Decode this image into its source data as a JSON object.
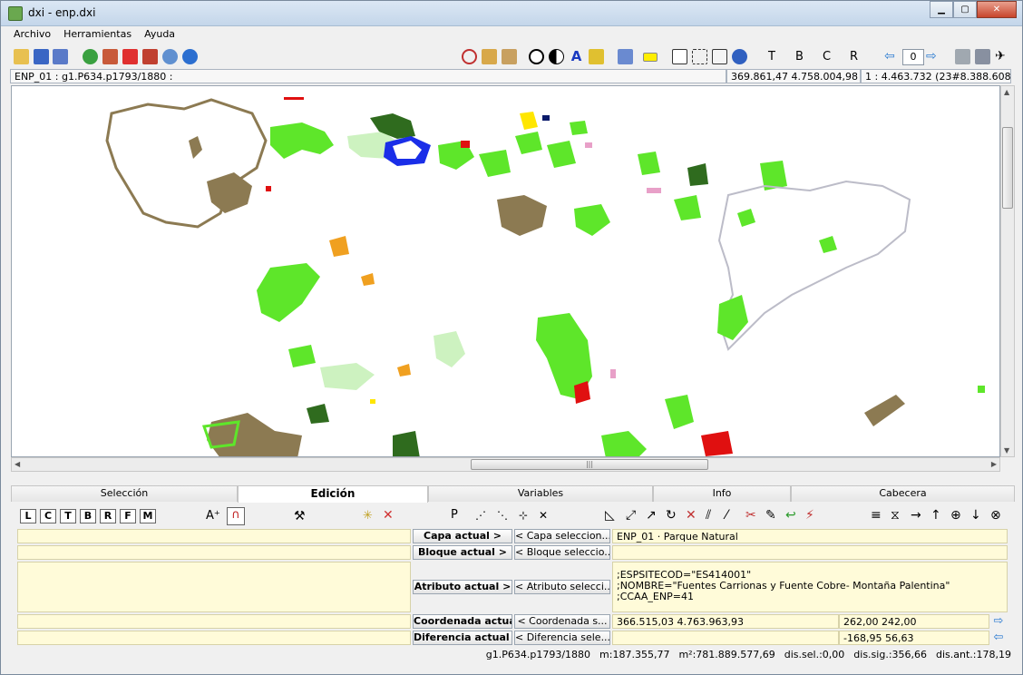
{
  "window": {
    "title": "dxi - enp.dxi"
  },
  "menu": {
    "items": [
      "Archivo",
      "Herramientas",
      "Ayuda"
    ]
  },
  "toolbar": {
    "page_number": "0",
    "label_t": "T",
    "label_b": "B",
    "label_c": "C",
    "label_r": "R"
  },
  "status_top": {
    "layer_info": "ENP_01 : g1.P634.p1793/1880 :",
    "coords": "369.861,47  4.758.004,98",
    "scale": "1 : 4.463.732 (23#8.388.608)"
  },
  "tabs": [
    "Selección",
    "Edición",
    "Variables",
    "Info",
    "Cabecera"
  ],
  "active_tab": 1,
  "edit_tools": {
    "letters": [
      "L",
      "C",
      "T",
      "B",
      "R",
      "F",
      "M"
    ]
  },
  "pen_label": "P",
  "panel": {
    "capa_actual_label": "Capa actual >",
    "capa_select_label": "< Capa seleccion...",
    "capa_value": "ENP_01 · Parque Natural",
    "bloque_actual_label": "Bloque actual >",
    "bloque_select_label": "< Bloque seleccio...",
    "bloque_value": "",
    "atributo_actual_label": "Atributo actual >",
    "atributo_select_label": "< Atributo selecci...",
    "atributo_lines": [
      ";ESPSITECOD=\"ES414001\"",
      ";NOMBRE=\"Fuentes Carrionas y Fuente Cobre- Montaña Palentina\"",
      ";CCAA_ENP=41"
    ],
    "coordenada_actual_label": "Coordenada actual...",
    "coordenada_select_label": "< Coordenada s...",
    "coordenada_value": "366.515,03  4.763.963,93",
    "coordenada_extra": "262,00  242,00",
    "diferencia_actual_label": "Diferencia actual >",
    "diferencia_select_label": "< Diferencia sele...",
    "diferencia_value": "",
    "diferencia_extra": "-168,95  56,63"
  },
  "status_bottom": {
    "ref": "g1.P634.p1793/1880",
    "m": "m:187.355,77",
    "m2": "m²:781.889.577,69",
    "dis_sel": "dis.sel.:0,00",
    "dis_sig": "dis.sig.:356,66",
    "dis_ant": "dis.ant.:178,19"
  },
  "colors": {
    "park_green": "#5ee62a",
    "dark_green": "#2f6b1e",
    "brown": "#8c7a52",
    "orange": "#f0a020",
    "blue": "#1a2ee8",
    "light_green": "#cdf2c0",
    "red": "#e01010",
    "gray_outline": "#bcbcc8",
    "pink": "#e8a0c8",
    "yellow": "#ffe600"
  }
}
